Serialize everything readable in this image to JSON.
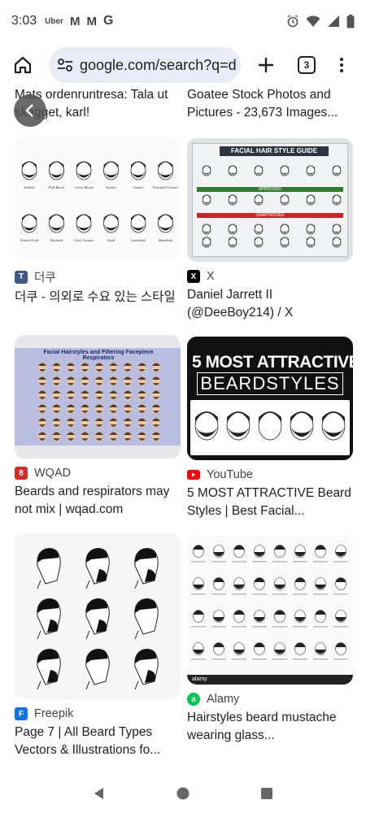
{
  "status_bar": {
    "time": "3:03",
    "notifications": {
      "uber": "Uber",
      "gmail1": "M",
      "gmail2": "M",
      "google": "G"
    }
  },
  "toolbar": {
    "url": "google.com/search?q=d",
    "tab_count": "3"
  },
  "results": {
    "top_left_title": "Mats ordenruntresa: Tala ut skägget, karl!",
    "top_right_title": "Goatee Stock Photos and Pictures - 23,673 Images...",
    "r1": {
      "source": "더쿠",
      "favicon": "T",
      "favicon_color": "#3d5a8a",
      "title": "더쿠 - 의외로 수요 있는 스타일",
      "beard_labels": [
        "Stubble",
        "Full Beard",
        "Circle Beard",
        "Anchor",
        "Goatee",
        "Extended Goatee",
        "French Fork",
        "Ducktail",
        "Chin Curtain",
        "Verdi",
        "Garibaldi",
        "Bandholz"
      ]
    },
    "r2": {
      "source": "X",
      "favicon": "X",
      "favicon_color": "#000000",
      "title": "Daniel Jarrett II (@DeeBoy214) / X",
      "guide_title": "FACIAL HAIR STYLE GUIDE",
      "approved": "APPROVED",
      "unapproved": "UNAPPROVED"
    },
    "r3": {
      "source": "WQAD",
      "favicon": "8",
      "favicon_color": "#d62b2b",
      "title": "Beards and respirators may not mix | wqad.com",
      "chart_title": "Facial Hairstyles and Filtering Facepiece Respirators"
    },
    "r4": {
      "source": "YouTube",
      "favicon_color": "#ff0000",
      "title": "5 MOST ATTRACTIVE Beard Styles | Best Facial...",
      "banner_line1": "5 MOST ATTRACTIVE",
      "banner_line2": "BEARDSTYLES"
    },
    "r5": {
      "source": "Freepik",
      "favicon": "F",
      "favicon_color": "#1273eb",
      "title": "Page 7 | All Beard Types Vectors & Illustrations fo..."
    },
    "r6": {
      "source": "Alamy",
      "favicon": "a",
      "favicon_color": "#00c853",
      "title": "Hairstyles beard mustache wearing glass...",
      "watermark": "alamy"
    }
  },
  "colors": {
    "accent": "#e7ecf7",
    "text": "#1f1f1f",
    "muted": "#444444"
  }
}
